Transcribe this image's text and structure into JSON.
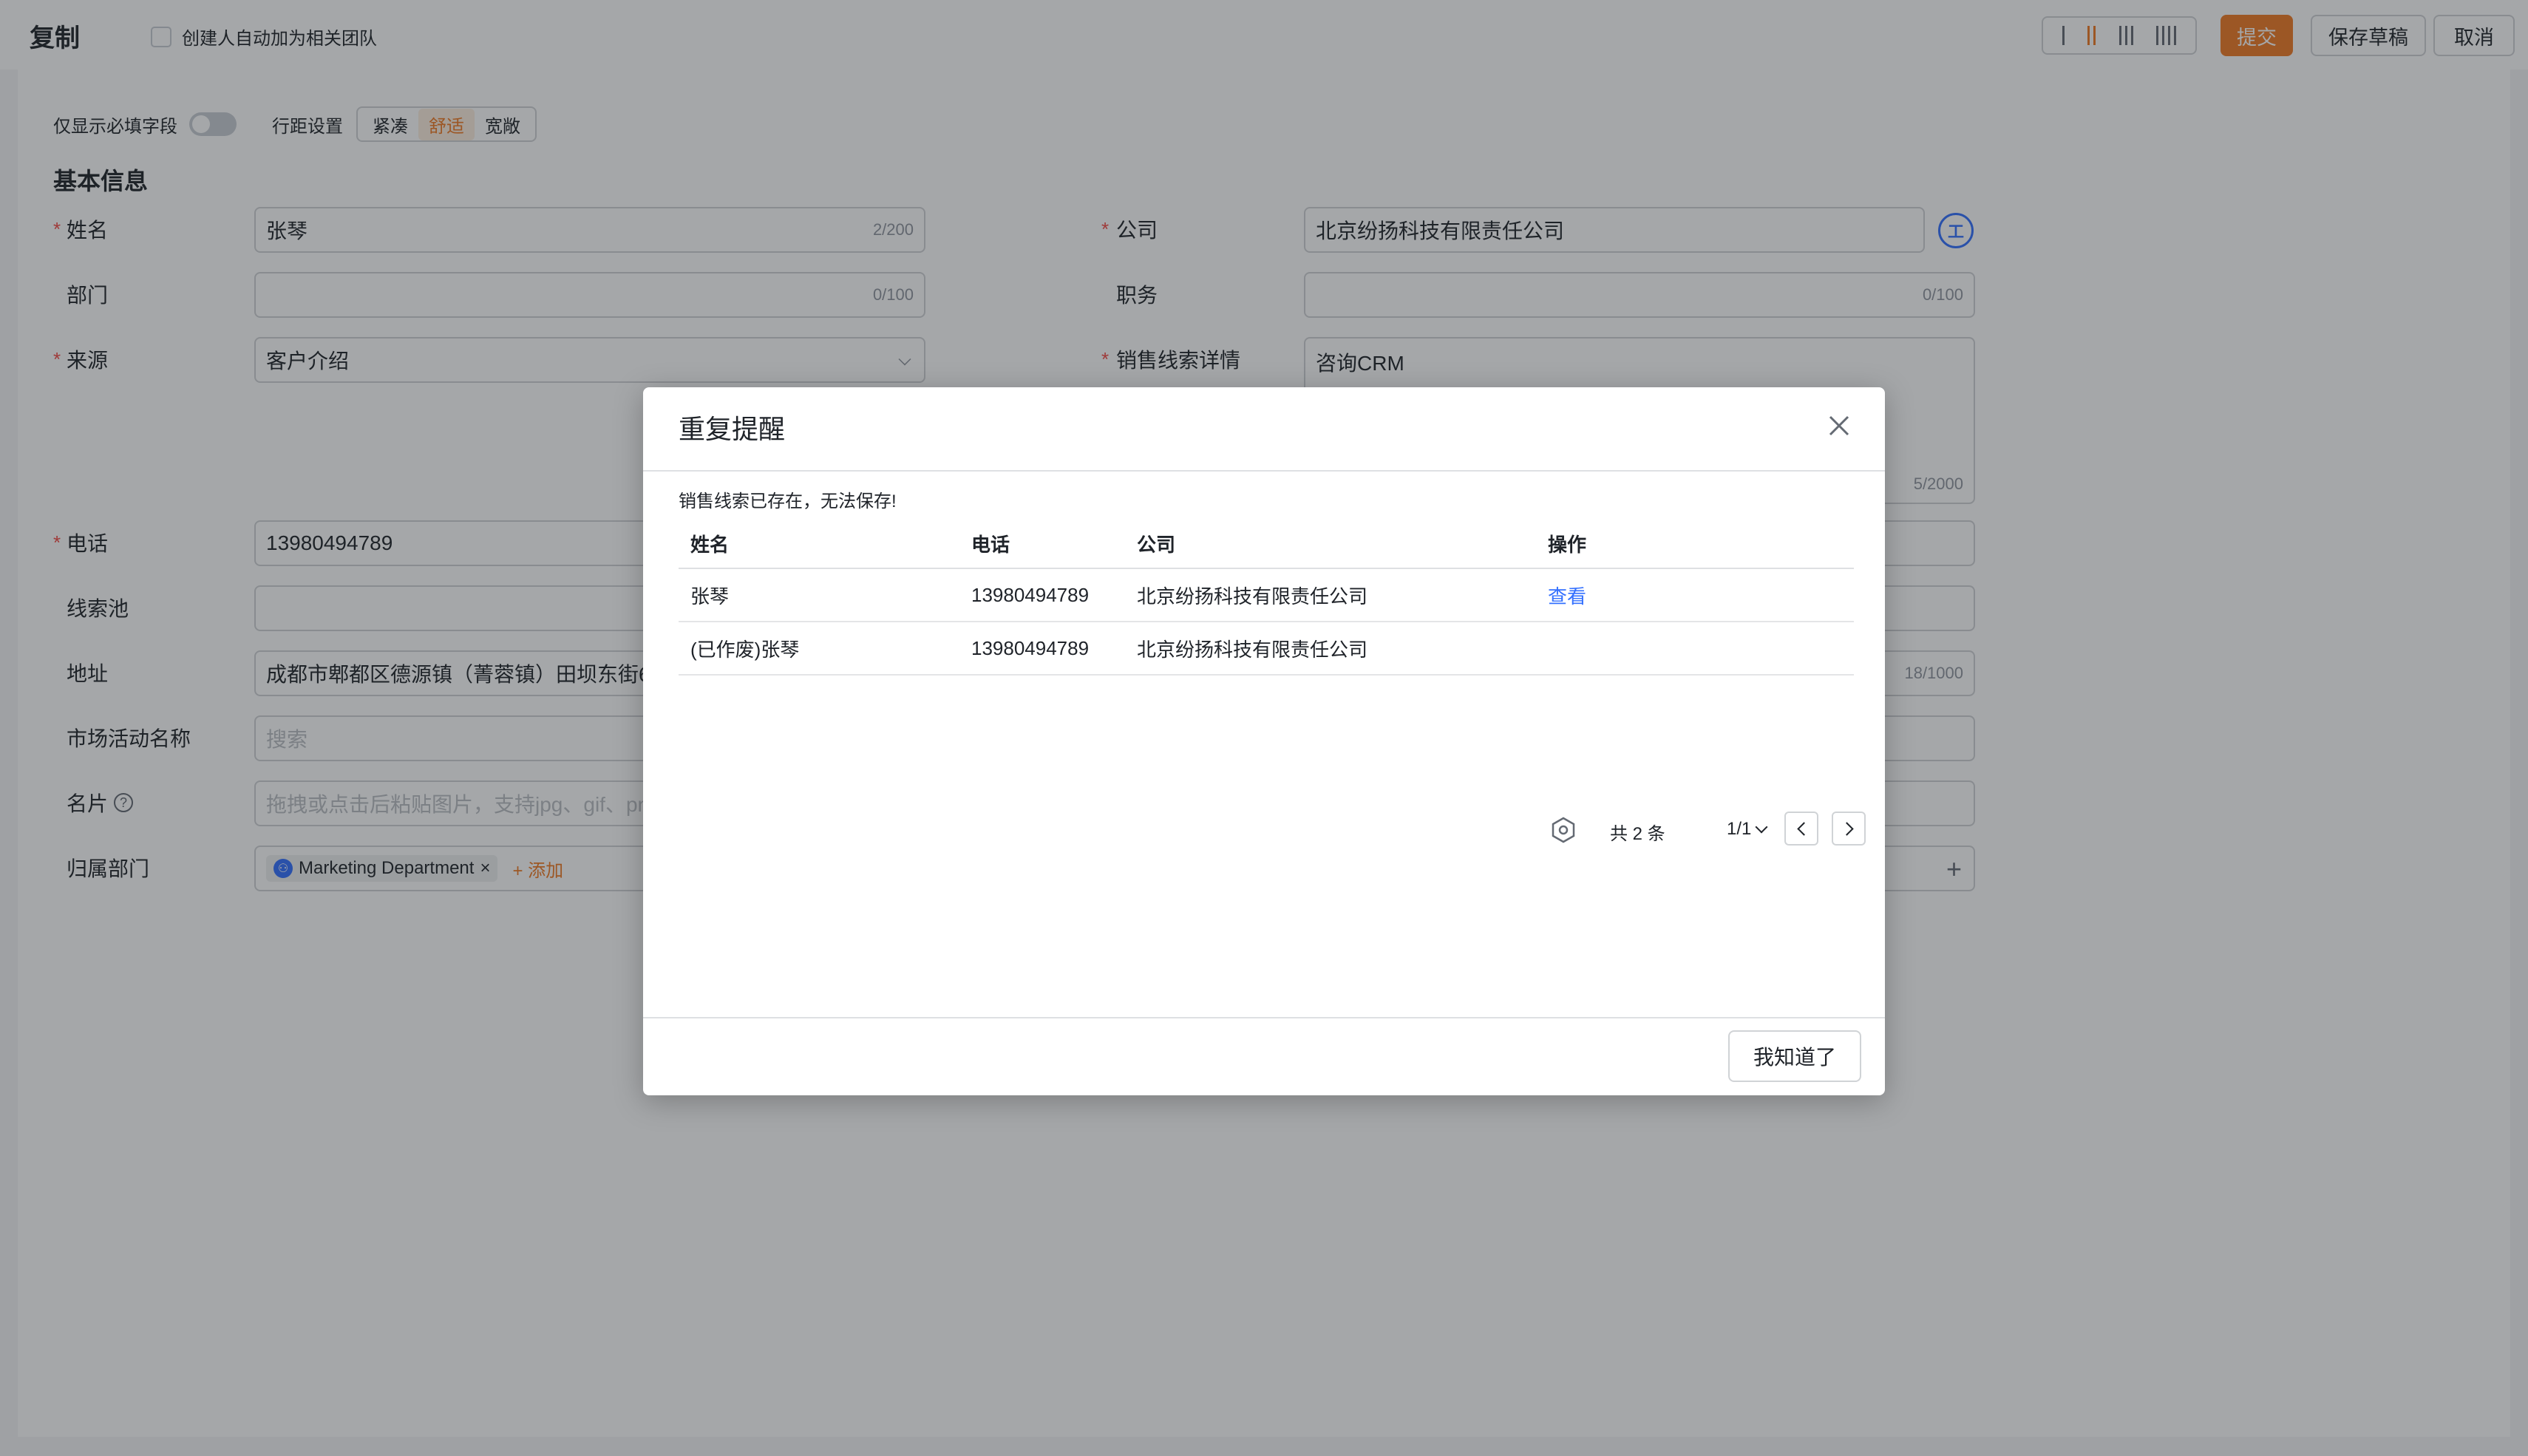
{
  "header": {
    "title": "复制",
    "auto_team_label": "创建人自动加为相关团队",
    "submit_label": "提交",
    "save_draft_label": "保存草稿",
    "cancel_label": "取消"
  },
  "toolbar": {
    "required_only_label": "仅显示必填字段",
    "spacing_label": "行距设置",
    "spacing_options": [
      "紧凑",
      "舒适",
      "宽敞"
    ],
    "spacing_selected": "舒适"
  },
  "section": {
    "title": "基本信息"
  },
  "form": {
    "name": {
      "label": "姓名",
      "value": "张琴",
      "count": "2/200"
    },
    "department": {
      "label": "部门",
      "value": "",
      "count": "0/100"
    },
    "source": {
      "label": "来源",
      "value": "客户介绍"
    },
    "company": {
      "label": "公司",
      "value": "北京纷扬科技有限责任公司",
      "icon_text": "工"
    },
    "position": {
      "label": "职务",
      "value": "",
      "count": "0/100"
    },
    "lead_detail": {
      "label": "销售线索详情",
      "value": "咨询CRM",
      "count": "5/2000"
    },
    "phone": {
      "label": "电话",
      "value": "13980494789"
    },
    "lead_pool": {
      "label": "线索池",
      "value": ""
    },
    "address": {
      "label": "地址",
      "value": "成都市郫都区德源镇（菁蓉镇）田坝东街6",
      "count": "18/1000"
    },
    "campaign": {
      "label": "市场活动名称",
      "placeholder": "搜索"
    },
    "business_card": {
      "label": "名片",
      "placeholder": "拖拽或点击后粘贴图片，支持jpg、gif、pn"
    },
    "owner_dept": {
      "label": "归属部门",
      "tag": "Marketing Department",
      "add_label": "+ 添加"
    }
  },
  "modal": {
    "title": "重复提醒",
    "message": "销售线索已存在，无法保存!",
    "columns": [
      "姓名",
      "电话",
      "公司",
      "操作"
    ],
    "rows": [
      {
        "name": "张琴",
        "phone": "13980494789",
        "company": "北京纷扬科技有限责任公司",
        "action": "查看"
      },
      {
        "name": "(已作废)张琴",
        "phone": "13980494789",
        "company": "北京纷扬科技有限责任公司",
        "action": ""
      }
    ],
    "pagination": {
      "total": "共 2 条",
      "page": "1/1"
    },
    "confirm_label": "我知道了"
  },
  "colors": {
    "accent": "#f07a24",
    "link": "#3370ff",
    "required": "#f54a45"
  }
}
